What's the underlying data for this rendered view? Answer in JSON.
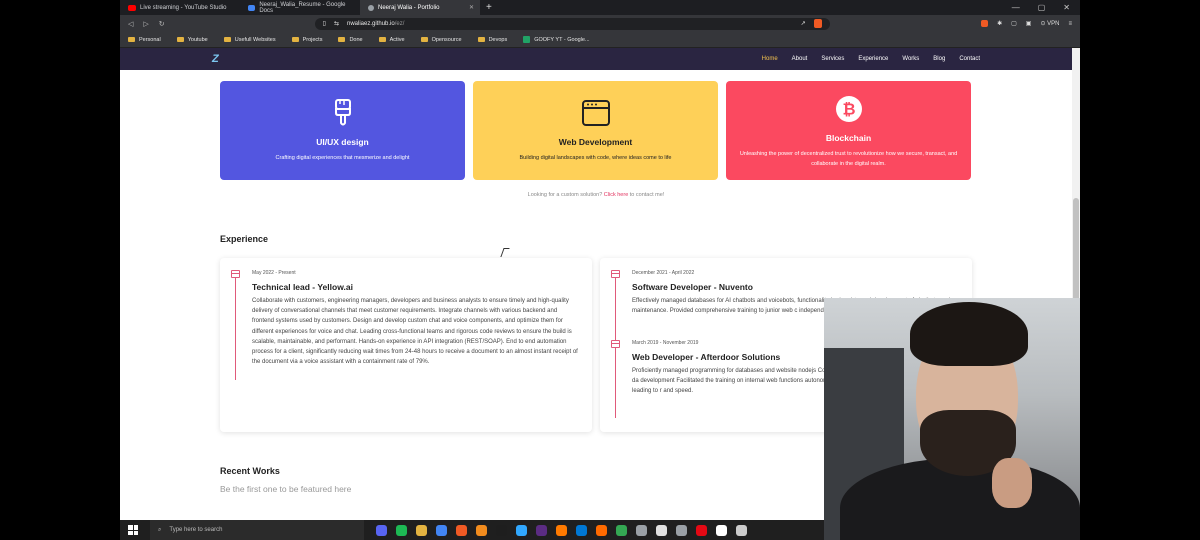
{
  "browser": {
    "tabs": [
      {
        "label": "Live streaming - YouTube Studio",
        "color": "#ff0000"
      },
      {
        "label": "Neeraj_Walia_Resume - Google Docs",
        "color": "#4285f4"
      },
      {
        "label": "Neeraj Walia - Portfolio",
        "color": "#9aa0a6"
      }
    ],
    "new_tab": "+",
    "close_glyph": "✕",
    "url_host": "nwaliaez.github.io",
    "url_path": "/ez/",
    "vpn": "VPN",
    "brave_badge": "1",
    "bookmarks": [
      "Personal",
      "Youtube",
      "Usefull Websites",
      "Projects",
      "Done",
      "Active",
      "Opensource",
      "Devops",
      "GOOFY YT - Google..."
    ]
  },
  "site": {
    "logo": "Z",
    "nav": [
      "Home",
      "About",
      "Services",
      "Experience",
      "Works",
      "Blog",
      "Contact"
    ],
    "services": [
      {
        "title": "UI/UX design",
        "desc": "Crafting digital experiences that mesmerize and delight",
        "icon": "brush-icon"
      },
      {
        "title": "Web Development",
        "desc": "Building digital landscapes with code, where ideas come to life",
        "icon": "browser-window-icon"
      },
      {
        "title": "Blockchain",
        "desc": "Unleashing the power of decentralized trust to revolutionize how we secure, transact, and collaborate in the digital realm.",
        "icon": "bitcoin-icon"
      }
    ],
    "custom_text": "Looking for a custom solution?",
    "custom_link": "Click here",
    "custom_suffix": "to contact me!",
    "experience_title": "Experience",
    "experience": [
      {
        "date": "May 2022 - Present",
        "title": "Technical lead - Yellow.ai",
        "desc": "Collaborate with customers, engineering managers, developers and business analysts to ensure timely and high-quality delivery of conversational channels that meet customer requirements. Integrate channels with various backend and frontend systems used by customers. Design and develop custom chat and voice components, and optimize them for different experiences for voice and chat. Leading cross-functional teams and rigorous code reviews to ensure the build is scalable, maintainable, and performant. Hands-on experience in API integration (REST/SOAP). End to end automation process for a client, significantly reducing wait times from 24-48 hours to receive a document to an almost instant receipt of the document via a voice assistant with a containment rate of 79%."
      },
      {
        "date": "December 2021 - April 2022",
        "title": "Software Developer - Nuvento",
        "desc": "Effectively managed databases for AI chatbots and voicebots, functionality Led end-to-end development of chatbots and vo maintenance. Provided comprehensive training to junior web c independent updates and changes to internal web functions."
      },
      {
        "date": "March 2019 - November 2019",
        "title": "Web Developer - Afterdoor Solutions",
        "desc": "Proficiently managed programming for databases and website nodejs Conducted research on mysql database to optimize da development Facilitated the training on internal web functions autonomously Successfully resolved website bugs, leading to r and speed."
      }
    ],
    "recent_title": "Recent Works",
    "recent_sub": "Be the first one to be featured here"
  },
  "taskbar": {
    "search_placeholder": "Type here to search",
    "apps": [
      "#5865f2",
      "#1db954",
      "#e3b341",
      "#4285f4",
      "#f05a24",
      "#f28c1e",
      "#1e1e1e",
      "#31a8ff",
      "#5b2c83",
      "#ff7a00",
      "#0078d4",
      "#ff6a00",
      "#34a853",
      "#9aa0a6",
      "#e0e0e0",
      "#9aa0a6",
      "#e50914",
      "#ffffff",
      "#cccccc"
    ]
  },
  "colors": {
    "uiux": "#5356e0",
    "webdev": "#fed058",
    "blockchain": "#fb4960",
    "accent": "#e2325f"
  }
}
